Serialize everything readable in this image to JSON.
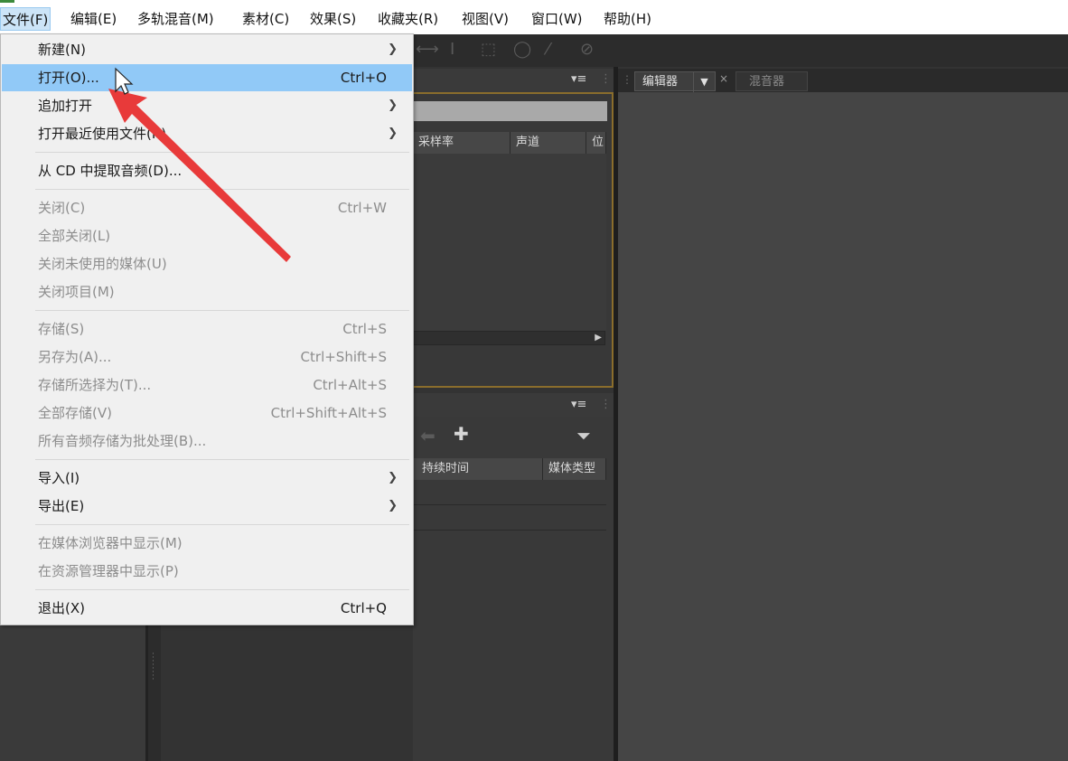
{
  "menubar": {
    "items": [
      "文件(F)",
      "编辑(E)",
      "多轨混音(M)",
      "素材(C)",
      "效果(S)",
      "收藏夹(R)",
      "视图(V)",
      "窗口(W)",
      "帮助(H)"
    ]
  },
  "file_menu": {
    "new": {
      "label": "新建(N)"
    },
    "open": {
      "label": "打开(O)...",
      "shortcut": "Ctrl+O"
    },
    "append_open": {
      "label": "追加打开"
    },
    "open_recent": {
      "label": "打开最近使用文件(R)"
    },
    "extract_cd": {
      "label": "从 CD 中提取音频(D)..."
    },
    "close": {
      "label": "关闭(C)",
      "shortcut": "Ctrl+W"
    },
    "close_all": {
      "label": "全部关闭(L)"
    },
    "close_unused": {
      "label": "关闭未使用的媒体(U)"
    },
    "close_session": {
      "label": "关闭项目(M)"
    },
    "save": {
      "label": "存储(S)",
      "shortcut": "Ctrl+S"
    },
    "save_as": {
      "label": "另存为(A)...",
      "shortcut": "Ctrl+Shift+S"
    },
    "save_selection": {
      "label": "存储所选择为(T)...",
      "shortcut": "Ctrl+Alt+S"
    },
    "save_all": {
      "label": "全部存储(V)",
      "shortcut": "Ctrl+Shift+Alt+S"
    },
    "save_all_batch": {
      "label": "所有音频存储为批处理(B)..."
    },
    "import": {
      "label": "导入(I)"
    },
    "export": {
      "label": "导出(E)"
    },
    "reveal_media_browser": {
      "label": "在媒体浏览器中显示(M)"
    },
    "reveal_explorer": {
      "label": "在资源管理器中显示(P)"
    },
    "exit": {
      "label": "退出(X)",
      "shortcut": "Ctrl+Q"
    }
  },
  "files_panel": {
    "columns": [
      "采样率",
      "声道",
      "位"
    ]
  },
  "media_panel": {
    "columns": [
      "持续时间",
      "媒体类型"
    ]
  },
  "editor": {
    "tabs": [
      "编辑器",
      "混音器"
    ]
  },
  "colors": {
    "highlight": "#91c9f7",
    "annotation_arrow": "#e83a3a",
    "panel_focus_border": "#8a6d2c"
  }
}
